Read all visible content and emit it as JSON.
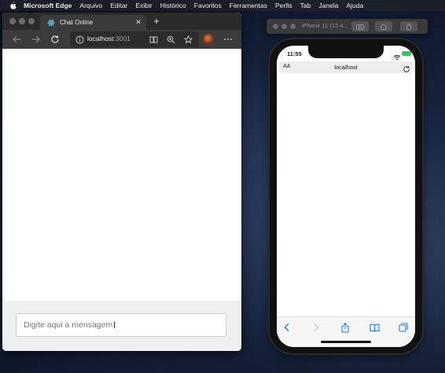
{
  "menubar": {
    "app_name": "Microsoft Edge",
    "items": [
      "Arquivo",
      "Editar",
      "Exibir",
      "Histórico",
      "Favoritos",
      "Ferramentas",
      "Perfis",
      "Tab",
      "Janela",
      "Ajuda"
    ]
  },
  "browser": {
    "tab_title": "Chat Online",
    "tab_close": "✕",
    "new_tab": "+",
    "url_host": "localhost",
    "url_port": ":3001"
  },
  "chat": {
    "input_placeholder": "Digite aqui a mensagem"
  },
  "simulator": {
    "title": "iPhone 11 (13.4..."
  },
  "iphone": {
    "time": "11:55",
    "aa_label": "AA",
    "host": "localhost"
  },
  "colors": {
    "accent_blue": "#1f7aff",
    "battery_green": "#34c759",
    "edge_toolbar": "#3b3b3b"
  },
  "icons": {
    "menubar": [
      "apple-icon"
    ],
    "browser_toolbar": [
      "back-arrow-icon",
      "forward-arrow-icon",
      "refresh-icon",
      "info-icon",
      "reading-view-icon",
      "zoom-icon",
      "favorite-star-icon",
      "profile-avatar",
      "more-options-icon"
    ],
    "safari_toolbar": [
      "back-chevron-icon",
      "forward-chevron-icon",
      "share-icon",
      "bookmarks-icon",
      "tabs-icon"
    ]
  }
}
